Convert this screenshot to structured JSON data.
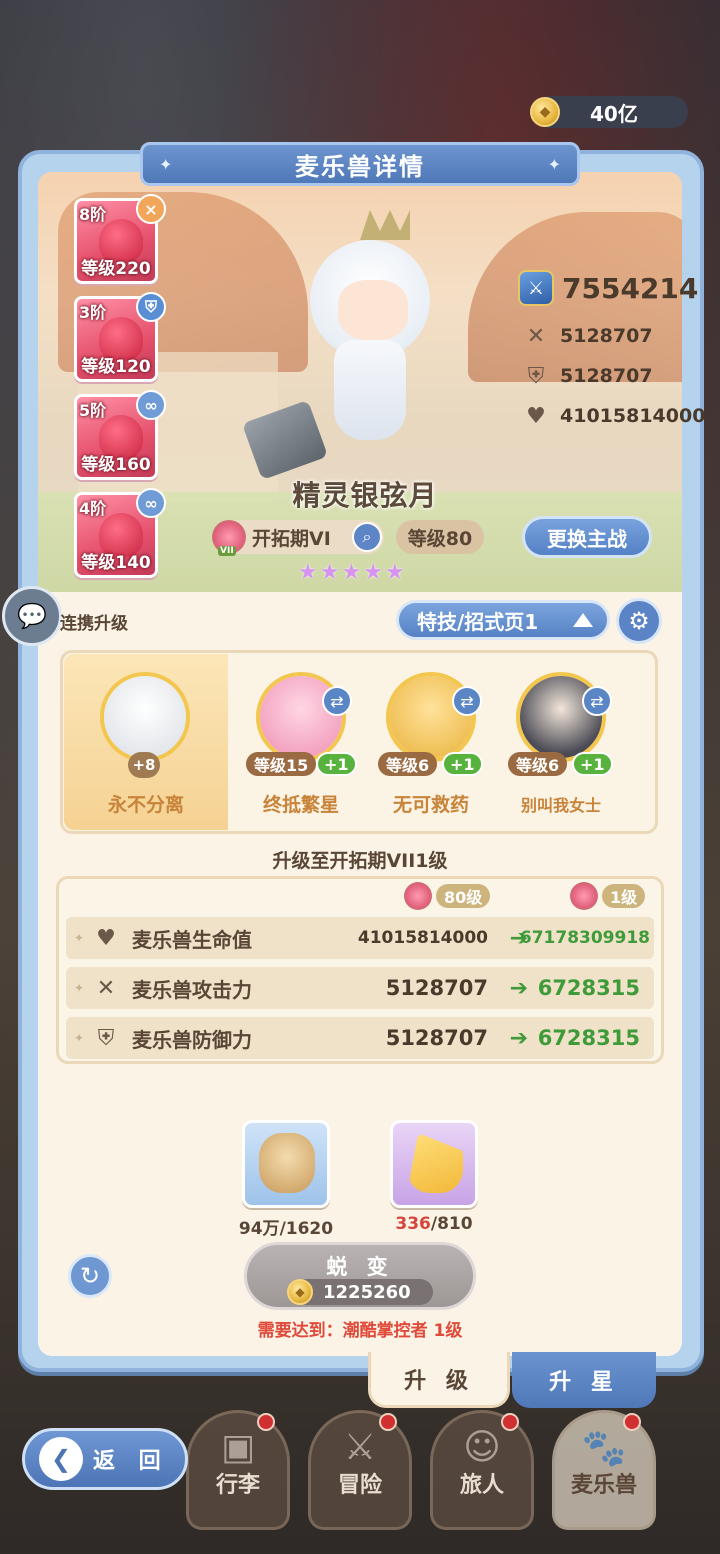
{
  "currency": {
    "amount": "40亿",
    "coin_icon": "gold-coin-icon"
  },
  "panel": {
    "title": "麦乐兽详情"
  },
  "pet_slots": [
    {
      "rank": "8阶",
      "level": "等级220",
      "badge": "×",
      "badge_color": "#f2a65a"
    },
    {
      "rank": "3阶",
      "level": "等级120",
      "badge": "⛨",
      "badge_color": "#5a8ed4"
    },
    {
      "rank": "5阶",
      "level": "等级160",
      "badge": "∞",
      "badge_color": "#6f9bd6"
    },
    {
      "rank": "4阶",
      "level": "等级140",
      "badge": "∞",
      "badge_color": "#6f9bd6"
    }
  ],
  "pet": {
    "name": "精灵银弦月",
    "era": "开拓期VI",
    "level": "等级80",
    "stars": 5,
    "power": "7554214",
    "attack": "5128707",
    "defense": "5128707",
    "hp": "41015814000"
  },
  "buttons": {
    "switch_main": "更换主战",
    "skill_page": "特技/招式页1",
    "upgrade_tab": "升 级",
    "star_tab": "升 星",
    "back": "返 回"
  },
  "combo": {
    "label": "连携升级"
  },
  "skills": {
    "main": {
      "name": "永不分离",
      "bonus": "+8"
    },
    "others": [
      {
        "name": "终抵繁星",
        "level": "等级15",
        "plus": "+1",
        "color": "#f4a8c8"
      },
      {
        "name": "无可救药",
        "level": "等级6",
        "plus": "+1",
        "color": "#f2c657"
      },
      {
        "name": "别叫我女士",
        "level": "等级6",
        "plus": "+1",
        "color": "#f0e0cf"
      }
    ]
  },
  "upgrade": {
    "title": "升级至开拓期VII1级",
    "from_level": "80级",
    "to_level": "1级",
    "rows": [
      {
        "name": "麦乐兽生命值",
        "icon": "heart-icon",
        "from": "41015814000",
        "to": "67178309918"
      },
      {
        "name": "麦乐兽攻击力",
        "icon": "swords-icon",
        "from": "5128707",
        "to": "6728315"
      },
      {
        "name": "麦乐兽防御力",
        "icon": "shield-icon",
        "from": "5128707",
        "to": "6728315"
      }
    ]
  },
  "materials": [
    {
      "name": "food-bag",
      "have": "94万",
      "need": "/1620",
      "insufficient": false
    },
    {
      "name": "cheese",
      "have": "336",
      "need": "/810",
      "insufficient": true
    }
  ],
  "evolve": {
    "label": "蜕 变",
    "cost": "1225260",
    "requirement": "需要达到：潮酷掌控者 1级"
  },
  "nav": [
    {
      "label": "行李",
      "glyph": "▣"
    },
    {
      "label": "冒险",
      "glyph": "⚔"
    },
    {
      "label": "旅人",
      "glyph": "☺"
    },
    {
      "label": "麦乐兽",
      "glyph": "🐾"
    }
  ]
}
